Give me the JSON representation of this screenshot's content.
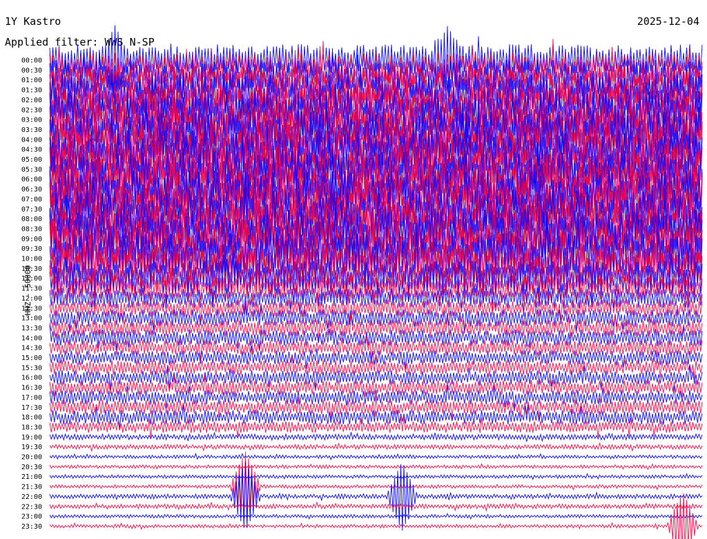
{
  "header": {
    "station": "1Y Kastro",
    "date": "2025-12-04",
    "filter": "Applied filter: WWS N-SP"
  },
  "chart_data": {
    "type": "line",
    "title": "1Y Kastro",
    "date": "2025-12-04",
    "filter": "Applied filter: WWS N-SP",
    "ylabel": "HHZ - 50000",
    "row_times": [
      "00:00",
      "00:30",
      "01:00",
      "01:30",
      "02:00",
      "02:30",
      "03:00",
      "03:30",
      "04:00",
      "04:30",
      "05:00",
      "05:30",
      "06:00",
      "06:30",
      "07:00",
      "07:30",
      "08:00",
      "08:30",
      "09:00",
      "09:30",
      "10:00",
      "10:30",
      "11:00",
      "11:30",
      "12:00",
      "12:30",
      "13:00",
      "13:30",
      "14:00",
      "14:30",
      "15:00",
      "15:30",
      "16:00",
      "16:30",
      "17:00",
      "17:30",
      "18:00",
      "18:30",
      "19:00",
      "19:30",
      "20:00",
      "20:30",
      "21:00",
      "21:30",
      "22:00",
      "22:30",
      "23:00",
      "23:30"
    ],
    "row_colors": [
      "#0000ff",
      "#ff0040"
    ],
    "relative_amplitude": [
      0.55,
      0.6,
      0.7,
      0.8,
      0.9,
      0.95,
      1,
      1,
      1,
      1,
      1,
      1,
      1,
      1,
      1,
      1,
      1,
      1,
      1,
      1,
      0.9,
      0.8,
      0.6,
      0.45,
      0.35,
      0.3,
      0.3,
      0.28,
      0.28,
      0.27,
      0.25,
      0.25,
      0.25,
      0.25,
      0.25,
      0.25,
      0.25,
      0.2,
      0.1,
      0.08,
      0.06,
      0.06,
      0.06,
      0.06,
      0.08,
      0.08,
      0.06,
      0.06
    ],
    "events": [
      {
        "time": "00:00",
        "x_frac": 0.1
      },
      {
        "time": "00:00",
        "x_frac": 0.61
      },
      {
        "time": "21:30",
        "x_frac": 0.3
      },
      {
        "time": "22:00",
        "x_frac": 0.3
      },
      {
        "time": "22:00",
        "x_frac": 0.54
      },
      {
        "time": "23:30",
        "x_frac": 0.97
      }
    ]
  }
}
